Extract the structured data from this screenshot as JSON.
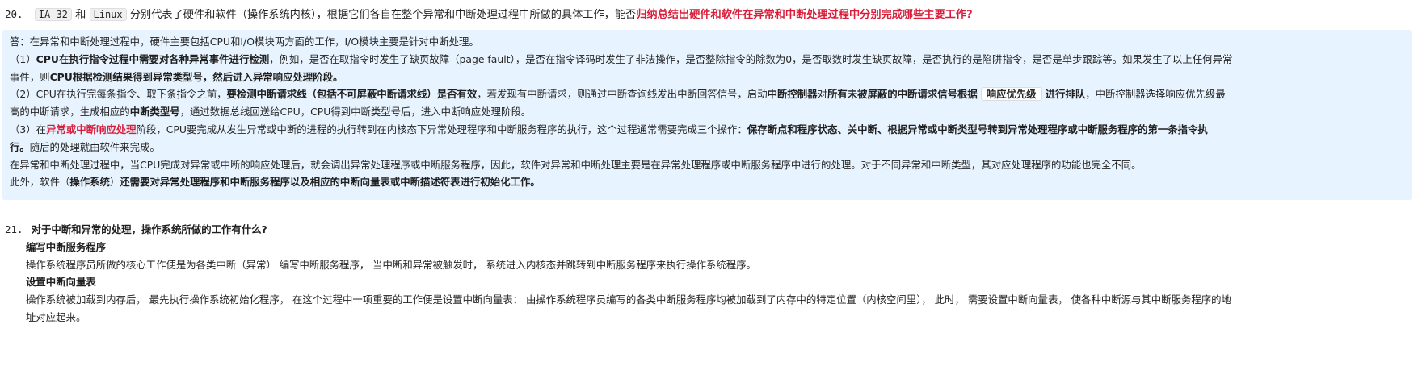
{
  "q20": {
    "number": "20.",
    "code1": "IA-32",
    "text_he": "和",
    "code2": "Linux",
    "text_mid": "分别代表了硬件和软件（操作系统内核），根据它们各自在整个异常和中断处理过程中所做的具体工作，能否",
    "text_red": "归纳总结出硬件和软件在异常和中断处理过程中分别完成哪些主要工作?"
  },
  "answer": {
    "line1": "答：在异常和中断处理过程中，硬件主要包括CPU和I/O模块两方面的工作，I/O模块主要是针对中断处理。",
    "p1_prefix": "（1）",
    "p1_bold1": "CPU在执行指令过程中需要对各种异常事件进行检测",
    "p1_text1": "，例如，是否在取指令时发生了缺页故障（page fault），是否在指令译码时发生了非法操作，是否整除指令的除数为0，是否取数时发生缺页故障，是否执行的是陷阱指令，是否是单步跟踪等。如果发生了以上任何异常",
    "p1_text2": "事件，则",
    "p1_bold2": "CPU根据检测结果得到异常类型号，然后进入异常响应处理阶段。",
    "p2_prefix": "（2）CPU在执行完每条指令、取下条指令之前，",
    "p2_bold1": "要检测中断请求线（包括不可屏蔽中断请求线）是否有效",
    "p2_text1": "，若发现有中断请求，则通过中断查询线发出中断回答信号，启动",
    "p2_bold2": "中断控制器",
    "p2_text2": "对",
    "p2_bold3": "所有未被屏蔽的中断请求信号根据",
    "p2_tag": "响应优先级",
    "p2_bold4": "进行排队",
    "p2_text3": "，中断控制器选择响应优先级最",
    "p2_text4": "高的中断请求，生成相应的",
    "p2_bold5": "中断类型号",
    "p2_text5": "，通过数据总线回送给CPU，CPU得到中断类型号后，进入中断响应处理阶段。",
    "p3_prefix": "（3）在",
    "p3_red": "异常或中断响应处理",
    "p3_text1": "阶段，CPU要完成从发生异常或中断的进程的执行转到在内核态下异常处理程序和中断服务程序的执行，这个过程通常需要完成三个操作：",
    "p3_bold1": "保存断点和程序状态、关中断、根据异常或中断类型号转到异常处理程序或中断服务程序的第一条指令执",
    "p3_bold2": "行。",
    "p3_text2": "随后的处理就由软件来完成。",
    "line_sw": "在异常和中断处理过程中，当CPU完成对异常或中断的响应处理后，就会调出异常处理程序或中断服务程序，因此，软件对异常和中断处理主要是在异常处理程序或中断服务程序中进行的处理。对于不同异常和中断类型，其对应处理程序的功能也完全不同。",
    "last_text1": "此外，软件（",
    "last_bold1": "操作系统",
    "last_text2": "）",
    "last_bold2": "还需要对异常处理程序和中断服务程序以及相应的中断向量表或中断描述符表进行初始化工作。"
  },
  "q21": {
    "number": "21.",
    "title": "对于中断和异常的处理，操作系统所做的工作有什么?",
    "h1": "编写中断服务程序",
    "t1": "操作系统程序员所做的核心工作便是为各类中断（异常） 编写中断服务程序， 当中断和异常被触发时， 系统进入内核态并跳转到中断服务程序来执行操作系统程序。",
    "h2": "设置中断向量表",
    "t2a": "操作系统被加载到内存后， 最先执行操作系统初始化程序， 在这个过程中一项重要的工作便是设置中断向量表： 由操作系统程序员编写的各类中断服务程序均被加载到了内存中的特定位置（内核空间里）， 此时， 需要设置中断向量表， 使各种中断源与其中断服务程序的地",
    "t2b": "址对应起来。"
  },
  "colors": {
    "answer_bg": "#e7f3fe",
    "highlight_red": "#d81e3a"
  }
}
